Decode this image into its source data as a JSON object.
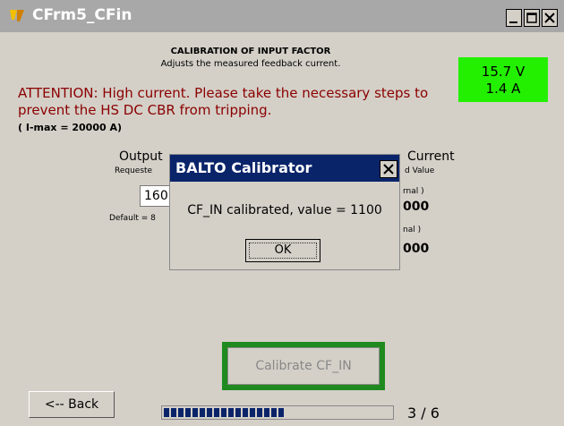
{
  "window": {
    "title": "CFrm5_CFin",
    "app_icon": "app-logo-icon",
    "controls": [
      "minimize-icon",
      "maximize-icon",
      "close-icon"
    ]
  },
  "header": {
    "heading": "CALIBRATION OF INPUT FACTOR",
    "subheading": "Adjusts the measured feedback current."
  },
  "status": {
    "voltage": "15.7 V",
    "current": "1.4 A",
    "color": "#23f000"
  },
  "warning": {
    "text": "ATTENTION: High current. Please take the necessary steps to prevent the HS DC CBR from tripping.",
    "color": "#8b0000",
    "imax": "( I-max = 20000 A)"
  },
  "output": {
    "title": "Output",
    "requested": "Requeste",
    "value": "160",
    "default": "Default = 8"
  },
  "current": {
    "title": "Current",
    "measured": "d Value",
    "internal1": "rnal )",
    "value1": "000",
    "internal2": "nal )",
    "value2": "000"
  },
  "calibrate": {
    "label": "Calibrate CF_IN",
    "frame_color": "#1f8a1f"
  },
  "nav": {
    "back": "<-- Back",
    "step": "3 / 6",
    "progress_fraction": 0.55
  },
  "dialog": {
    "title": "BALTO Calibrator",
    "message": "CF_IN calibrated, value = 1100",
    "ok": "OK",
    "title_color": "#0a246a"
  }
}
